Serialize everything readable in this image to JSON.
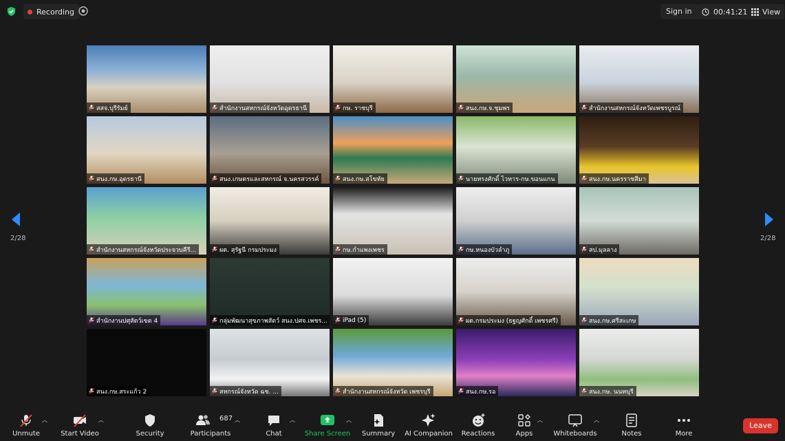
{
  "topbar": {
    "recording_label": "Recording",
    "signin_label": "Sign in",
    "timer": "00:41:21",
    "view_label": "View"
  },
  "pagination": {
    "left": "2/28",
    "right": "2/28"
  },
  "participants": [
    {
      "name": "สสจ.บุรีรัมย์"
    },
    {
      "name": "สำนักงานสหกรณ์จังหวัดอุดรธานี"
    },
    {
      "name": "กษ. ราชบุรี"
    },
    {
      "name": "สนง.กษ.จ.ชุมพร"
    },
    {
      "name": "สำนักงานสหกรณ์จังหวัดเพชรบูรณ์"
    },
    {
      "name": "สนง.กษ.อุดรธานี"
    },
    {
      "name": "สนง.เกษตรและสหกรณ์ จ.นครสวรรค์"
    },
    {
      "name": "สนง.กษ.สโขทัย"
    },
    {
      "name": "นายทรงศักดิ์ ไวทาร-กษ.ขอนแกน"
    },
    {
      "name": "สนง.กษ.นครราชสีมา"
    },
    {
      "name": "สำนักงานสหกรณ์จังหวัดประจวบคีรี..."
    },
    {
      "name": "ผต. สุรัฐนี กรมประมง"
    },
    {
      "name": "กษ.กำแพงเพชร"
    },
    {
      "name": "กษ.หนองบัวลำภู"
    },
    {
      "name": "สป.มุลลาง"
    },
    {
      "name": "สำนักงานปศุสัตว์เขต 4"
    },
    {
      "name": "กลุ่มพัฒนาสุขภาพสัตว์ สนง.ปศจ.เพชร..."
    },
    {
      "name": "iPad (5)"
    },
    {
      "name": "ผต.กรมประมง (ธฐญศักดิ์ เพชรศรี)"
    },
    {
      "name": "สนง.กษ.ศรีสะเกษ"
    },
    {
      "name": "สนง.กษ.สระแก้ว 2"
    },
    {
      "name": "สหกรณ์จังหวัด ฉช. ..."
    },
    {
      "name": "สำนักงานสหกรณ์จังหวัด เพชรบุรี"
    },
    {
      "name": "สนง.กษ.รอ"
    },
    {
      "name": "สนง.กษ. นนทบุรี"
    }
  ],
  "toolbar": {
    "unmute": "Unmute",
    "start_video": "Start Video",
    "security": "Security",
    "participants": "Participants",
    "participants_count": "687",
    "chat": "Chat",
    "share_screen": "Share Screen",
    "summary": "Summary",
    "ai_companion": "AI Companion",
    "reactions": "Reactions",
    "apps": "Apps",
    "whiteboards": "Whiteboards",
    "notes": "Notes",
    "more": "More",
    "leave": "Leave"
  },
  "colors": {
    "share_green": "#21c263",
    "leave_red": "#d9342b",
    "arrow_blue": "#2d8cff",
    "muted_red": "#e0453a"
  },
  "icons": [
    "shield-icon",
    "record-dot-icon",
    "target-icon",
    "clock-icon",
    "grid-view-icon",
    "mic-off-icon",
    "video-off-icon",
    "security-icon",
    "participants-icon",
    "chat-icon",
    "share-screen-icon",
    "summary-icon",
    "sparkle-icon",
    "reactions-icon",
    "apps-icon",
    "whiteboard-icon",
    "notes-icon",
    "more-icon",
    "prev-page-icon",
    "next-page-icon"
  ]
}
